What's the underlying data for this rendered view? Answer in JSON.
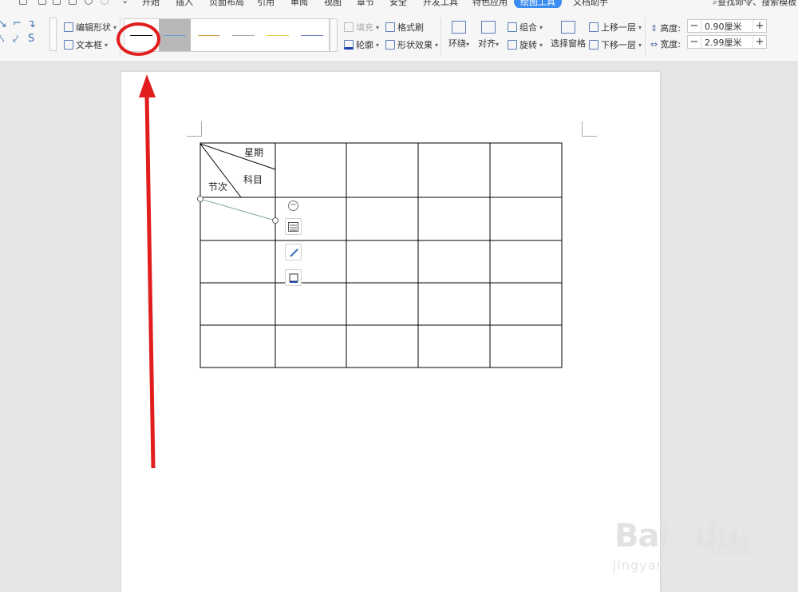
{
  "menu": {
    "tabs": [
      "开始",
      "插入",
      "页面布局",
      "引用",
      "审阅",
      "视图",
      "章节",
      "安全",
      "开发工具",
      "特色应用",
      "绘图工具",
      "文档助手"
    ],
    "active_tab": "绘图工具",
    "search_placeholder": "查找命令、搜索模板"
  },
  "ribbon": {
    "edit_shape": "编辑形状",
    "text_box": "文本框",
    "fill": "填充",
    "format_painter": "格式刷",
    "outline": "轮廓",
    "shape_effects": "形状效果",
    "wrap": "环绕",
    "align": "对齐",
    "group": "组合",
    "rotate": "旋转",
    "selection_pane": "选择窗格",
    "bring_forward": "上移一层",
    "send_backward": "下移一层",
    "height_label": "高度:",
    "height_value": "0.90厘米",
    "width_label": "宽度:",
    "width_value": "2.99厘米",
    "line_styles": [
      {
        "color": "#000000"
      },
      {
        "color": "#6a9fd2"
      },
      {
        "color": "#d4a34d"
      },
      {
        "color": "#a6a6a6"
      },
      {
        "color": "#e8c832"
      },
      {
        "color": "#5b7fb4"
      }
    ],
    "selected_style": 1
  },
  "table": {
    "header_top": "星期",
    "header_mid": "科目",
    "header_left": "节次",
    "rows": 5,
    "cols": 5
  },
  "watermark": {
    "brand": "Bai",
    "brand2": "du",
    "cn": "经验",
    "url": "jingyan.baidu.com"
  },
  "colors": {
    "accent": "#3b8cf0",
    "annotation": "#e11d1d"
  }
}
